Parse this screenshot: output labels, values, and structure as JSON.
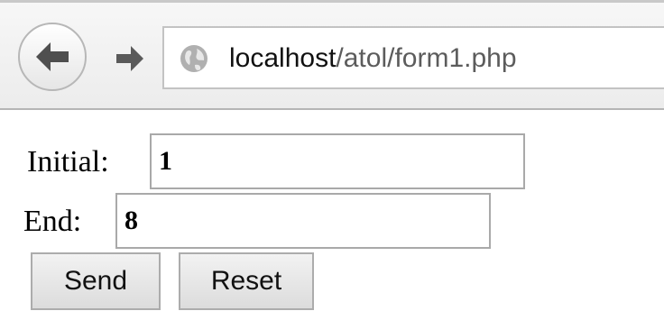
{
  "browser": {
    "back_icon": "arrow-left",
    "forward_icon": "arrow-right",
    "site_icon": "globe",
    "url_host": "localhost",
    "url_path": "/atol/form1.php"
  },
  "form": {
    "initial_label": "Initial:",
    "initial_value": "1",
    "end_label": "End:",
    "end_value": "8",
    "send_label": "Send",
    "reset_label": "Reset"
  }
}
